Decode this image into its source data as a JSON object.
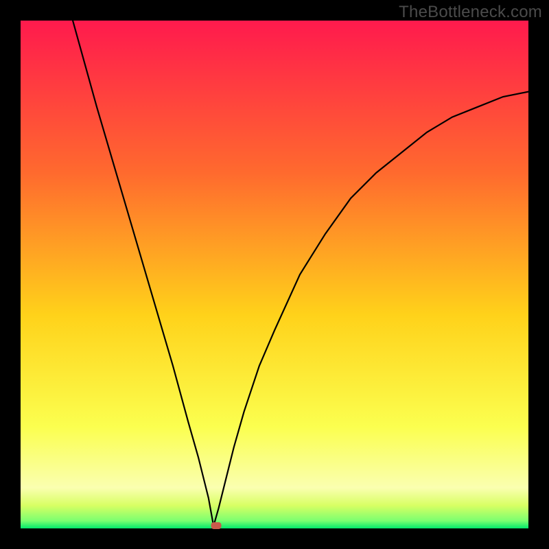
{
  "watermark": "TheBottleneck.com",
  "colors": {
    "frame": "#000000",
    "gradient_top": "#ff1a4d",
    "gradient_mid_upper": "#ff6a2e",
    "gradient_mid": "#ffd21a",
    "gradient_mid_lower": "#fbff4f",
    "gradient_low": "#d8ff63",
    "gradient_bottom": "#00e86b",
    "curve": "#000000",
    "dot": "#c95b4b"
  },
  "chart_data": {
    "type": "line",
    "title": "",
    "xlabel": "",
    "ylabel": "",
    "xlim": [
      0,
      100
    ],
    "ylim": [
      0,
      100
    ],
    "minimum_x": 38,
    "dot": {
      "x": 38.5,
      "y": 0.5
    },
    "series": [
      {
        "name": "bottleneck-curve",
        "x": [
          0,
          5,
          10,
          15,
          20,
          25,
          30,
          33,
          35,
          36,
          37,
          38,
          39,
          40,
          41,
          42,
          44,
          47,
          50,
          55,
          60,
          65,
          70,
          75,
          80,
          85,
          90,
          95,
          100
        ],
        "y": [
          140,
          120,
          101,
          83,
          66,
          49,
          32,
          21,
          14,
          10,
          6,
          0.5,
          4,
          8,
          12,
          16,
          23,
          32,
          39,
          50,
          58,
          65,
          70,
          74,
          78,
          81,
          83,
          85,
          86
        ]
      }
    ]
  }
}
